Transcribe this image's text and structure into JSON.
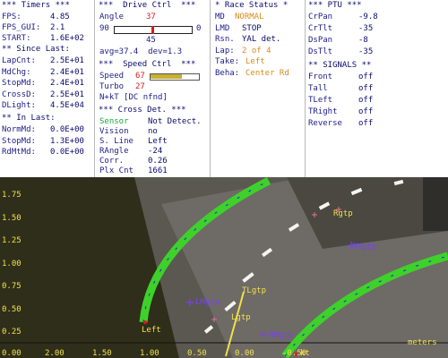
{
  "timers": {
    "header": "*** Timers ***",
    "fps_label": "FPS:",
    "fps": "4.85",
    "fps_gui_label": "FPS_GUI:",
    "fps_gui": "2.1",
    "start_label": "START:",
    "start": "1.6E+02",
    "since_header": "** Since Last:",
    "since": [
      {
        "label": "LapCnt:",
        "value": "2.5E+01"
      },
      {
        "label": "MdChg:",
        "value": "2.4E+01"
      },
      {
        "label": "StopMd:",
        "value": "2.4E+01"
      },
      {
        "label": "CrossD:",
        "value": "2.5E+01"
      },
      {
        "label": "DLight:",
        "value": "4.5E+04"
      }
    ],
    "in_header": "** In Last:",
    "in_last": [
      {
        "label": "NormMd:",
        "value": "0.0E+00"
      },
      {
        "label": "StopMd:",
        "value": "1.3E+00"
      },
      {
        "label": "RdMtMd:",
        "value": "0.0E+00"
      }
    ]
  },
  "drive": {
    "header": "***  Drive Ctrl  ***",
    "angle_label": "Angle",
    "angle": "37",
    "bar_left": "90",
    "bar_right": "0",
    "bar_center": "45",
    "avg": "avg=37.4  dev=1.3",
    "speed_header": "***  Speed Ctrl  ***",
    "speed_label": "Speed",
    "speed": "67",
    "speed_level": 0.67,
    "turbo_label": "Turbo",
    "turbo": "27",
    "nkt": "N+kT [DC nfnd]",
    "cross_header": "*** Cross Det. ***",
    "cross_rows": [
      {
        "label": "Sensor",
        "value": "Not Detect."
      },
      {
        "label": "Vision",
        "value": "no"
      },
      {
        "label": "S. Line",
        "value": "Left"
      },
      {
        "label": "RAngle",
        "value": "-24"
      },
      {
        "label": "Corr.",
        "value": "0.26"
      },
      {
        "label": "Plx Cnt",
        "value": "1661"
      }
    ]
  },
  "race": {
    "header": "* Race Status *",
    "rows": [
      {
        "label": "MD",
        "value": "NORMAL",
        "color": "#d98a1a"
      },
      {
        "label": "LMD",
        "value": "STOP",
        "color": "#0a0a6e"
      },
      {
        "label": "Rsn.",
        "value": "YAL det.",
        "color": "#0a0a6e"
      },
      {
        "label": "Lap:",
        "value": "2 of 4",
        "color": "#d98a1a"
      },
      {
        "label": "Take:",
        "value": "Left",
        "color": "#d98a1a"
      },
      {
        "label": "Beha:",
        "value": "Center Rd",
        "color": "#d98a1a"
      }
    ]
  },
  "ptu": {
    "header": "*** PTU ***",
    "rows": [
      {
        "label": "CrPan",
        "value": "-9.8"
      },
      {
        "label": "CrTlt",
        "value": "-35"
      },
      {
        "label": "DsPan",
        "value": "-8"
      },
      {
        "label": "DsTlt",
        "value": "-35"
      }
    ],
    "signals_header": "** SIGNALS **",
    "signals": [
      {
        "label": "Front",
        "value": "off"
      },
      {
        "label": "Tall",
        "value": "off"
      },
      {
        "label": "TLeft",
        "value": "off"
      },
      {
        "label": "TRight",
        "value": "off"
      },
      {
        "label": "Reverse",
        "value": "off"
      }
    ]
  },
  "view": {
    "y_ticks": [
      "1.75",
      "1.50",
      "1.25",
      "1.00",
      "0.75",
      "0.50",
      "0.25"
    ],
    "x_ticks": [
      "2.00",
      "1.50",
      "1.00",
      "0.50",
      "0.00",
      "-0.50"
    ],
    "x_edge": "0.00",
    "unit": "meters",
    "labels": {
      "left": "Left",
      "lmgtp": "LMgtp",
      "tlgtp": "TLgtp",
      "lgtp": "Lgtp",
      "rgtp": "Rgtp",
      "rmgtp": "RMgtp",
      "rmgtp2": "RMgtp",
      "kt": "kt"
    },
    "colors": {
      "lane": "#3ed12a",
      "marks": "#2222dd",
      "axis_text": "#f2e04a"
    }
  }
}
